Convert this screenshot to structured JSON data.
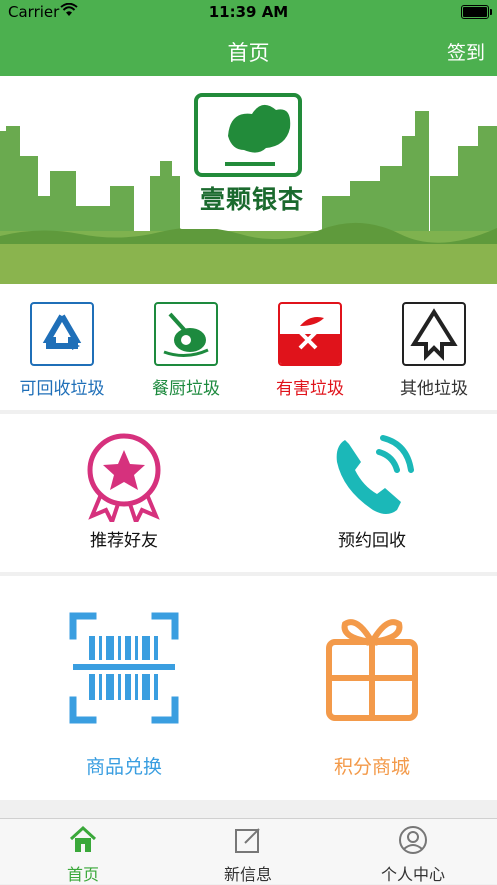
{
  "status": {
    "carrier": "Carrier",
    "time": "11:39 AM"
  },
  "nav": {
    "title": "首页",
    "right": "签到"
  },
  "banner": {
    "brand": "壹颗银杏",
    "slides": 3,
    "active_slide": 0
  },
  "categories": [
    {
      "label": "可回收垃圾",
      "color": "#1f6fb8"
    },
    {
      "label": "餐厨垃圾",
      "color": "#1d8a3e"
    },
    {
      "label": "有害垃圾",
      "color": "#e0131b"
    },
    {
      "label": "其他垃圾",
      "color": "#333333"
    }
  ],
  "features": [
    {
      "label": "推荐好友",
      "color": "#d6317d"
    },
    {
      "label": "预约回收",
      "color": "#1bb8b8"
    }
  ],
  "features2": [
    {
      "label": "商品兑换",
      "color": "#3a9ee0"
    },
    {
      "label": "积分商城",
      "color": "#f39a4a"
    }
  ],
  "tabs": [
    {
      "label": "首页",
      "active": true
    },
    {
      "label": "新信息",
      "active": false
    },
    {
      "label": "个人中心",
      "active": false
    }
  ]
}
